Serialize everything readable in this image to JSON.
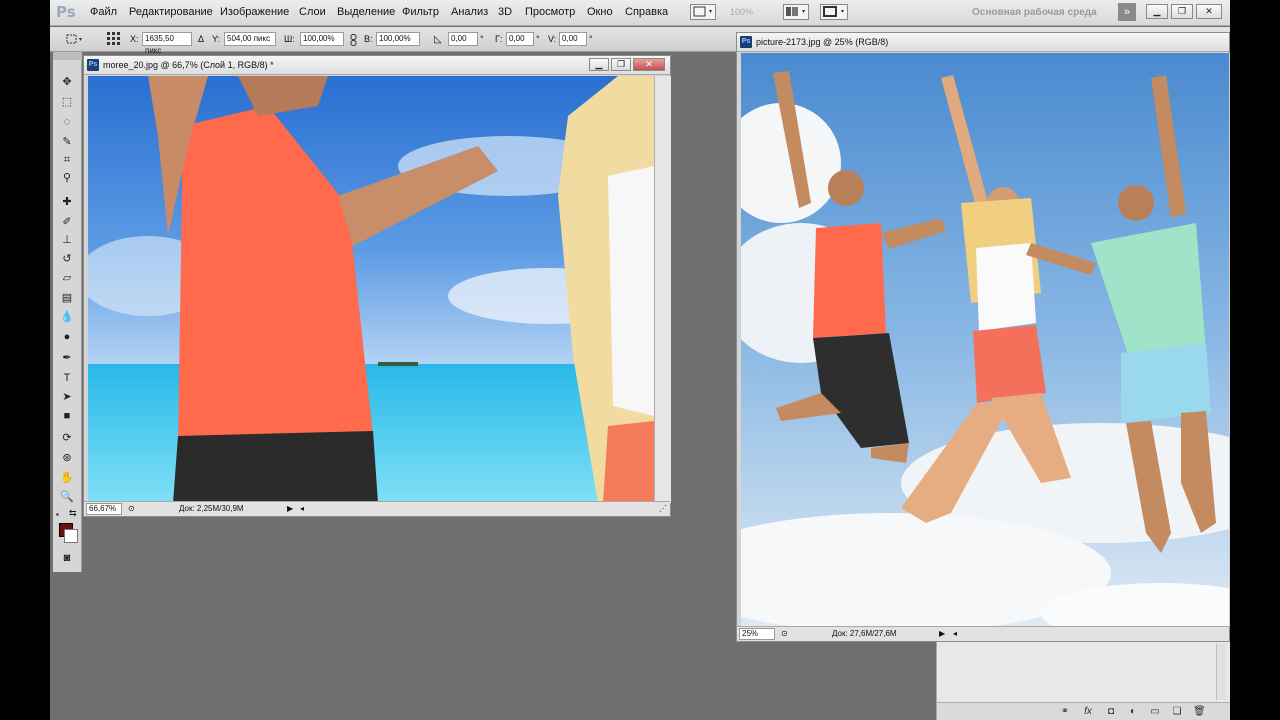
{
  "app": {
    "logo": "Ps",
    "workspace": "Основная рабочая среда",
    "zoom_combo": "100%"
  },
  "menu": [
    "Файл",
    "Редактирование",
    "Изображение",
    "Слои",
    "Выделение",
    "Фильтр",
    "Анализ",
    "3D",
    "Просмотр",
    "Окно",
    "Справка"
  ],
  "options": {
    "x_label": "X:",
    "x_value": "1635,50 пикс",
    "y_label": "Y:",
    "y_value": "504,00 пикс",
    "w_label": "Ш:",
    "w_value": "100,00%",
    "h_label": "В:",
    "h_value": "100,00%",
    "angle_value": "0,00",
    "angle_unit": "°",
    "hskew_label": "Г:",
    "hskew_value": "0,00",
    "hskew_unit": "°",
    "vskew_label": "V:",
    "vskew_value": "0,00",
    "vskew_unit": "°"
  },
  "doc1": {
    "title": "moree_20.jpg @ 66,7% (Слой 1, RGB/8) *",
    "zoom": "66,67%",
    "info": "Док: 2,25M/30,9M"
  },
  "doc2": {
    "title": "picture-2173.jpg @ 25% (RGB/8)",
    "zoom": "25%",
    "info": "Док: 27,6M/27,6M"
  },
  "colors": {
    "foreground": "#6b0f0f",
    "background": "#ffffff",
    "workspace_bg": "#6f6f6f"
  },
  "icons": [
    "move-icon",
    "marquee-icon",
    "lasso-icon",
    "quick-select-icon",
    "crop-icon",
    "eyedropper-icon",
    "healing-icon",
    "brush-icon",
    "stamp-icon",
    "history-brush-icon",
    "eraser-icon",
    "gradient-icon",
    "blur-icon",
    "dodge-icon",
    "pen-icon",
    "type-icon",
    "path-select-icon",
    "shape-icon",
    "3d-rotate-icon",
    "3d-orbit-icon",
    "hand-icon",
    "zoom-icon"
  ]
}
